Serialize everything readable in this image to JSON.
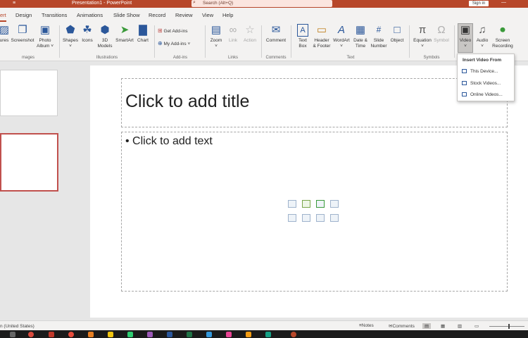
{
  "titlebar": {
    "title": "Presentation1 - PowerPoint",
    "qat_glyph": "≡",
    "search_placeholder": "Search (Alt+Q)",
    "signin_label": "Sign in",
    "accent": "#b7472a"
  },
  "tabs": [
    "ert",
    "Design",
    "Transitions",
    "Animations",
    "Slide Show",
    "Record",
    "Review",
    "View",
    "Help"
  ],
  "ribbon": {
    "buttons": [
      {
        "label": "ures",
        "glyph": "▨",
        "disabled": false
      },
      {
        "label": "Screenshot",
        "glyph": "❐",
        "disabled": false
      },
      {
        "label": "Photo\nAlbum ˅",
        "glyph": "▣",
        "disabled": false
      },
      {
        "label": "Shapes\n˅",
        "glyph": "⬟",
        "disabled": false
      },
      {
        "label": "Icons",
        "glyph": "☘",
        "disabled": false
      },
      {
        "label": "3D\nModels",
        "glyph": "⬢",
        "disabled": false
      },
      {
        "label": "SmartArt",
        "glyph": "➤",
        "disabled": false
      },
      {
        "label": "Chart",
        "glyph": "▇",
        "disabled": false
      },
      {
        "label": "Get Add-ins",
        "glyph": "⊞",
        "disabled": false
      },
      {
        "label": "My Add-ins ˅",
        "glyph": "⊕",
        "disabled": false
      },
      {
        "label": "Zoom\n˅",
        "glyph": "▤",
        "disabled": false
      },
      {
        "label": "Link",
        "glyph": "∞",
        "disabled": true
      },
      {
        "label": "Action",
        "glyph": "☆",
        "disabled": true
      },
      {
        "label": "Comment",
        "glyph": "✉",
        "disabled": false
      },
      {
        "label": "Text\nBox",
        "glyph": "A",
        "disabled": false
      },
      {
        "label": "Header\n& Footer",
        "glyph": "▭",
        "disabled": false
      },
      {
        "label": "WordArt\n˅",
        "glyph": "A",
        "disabled": false
      },
      {
        "label": "Date &\nTime",
        "glyph": "▦",
        "disabled": false
      },
      {
        "label": "Slide\nNumber",
        "glyph": "#",
        "disabled": false
      },
      {
        "label": "Object",
        "glyph": "□",
        "disabled": false
      },
      {
        "label": "Equation\n˅",
        "glyph": "π",
        "disabled": false
      },
      {
        "label": "Symbol",
        "glyph": "Ω",
        "disabled": true
      },
      {
        "label": "Video\n˅",
        "glyph": "▣",
        "disabled": false
      },
      {
        "label": "Audio\n˅",
        "glyph": "♫",
        "disabled": false
      },
      {
        "label": "Screen\nRecording",
        "glyph": "⏺",
        "disabled": false
      }
    ],
    "groups": [
      "mages",
      "Illustrations",
      "Add-ins",
      "Links",
      "Comments",
      "Text",
      "Symbols"
    ]
  },
  "video_menu": {
    "header": "Insert Video From",
    "items": [
      "This Device...",
      "Stock Videos...",
      "Online Videos..."
    ]
  },
  "slide": {
    "title_placeholder": "Click to add title",
    "body_placeholder": "• Click to add text"
  },
  "status": {
    "language": "n (United States)",
    "notes": "≡Notes",
    "comments": "✉Comments"
  }
}
